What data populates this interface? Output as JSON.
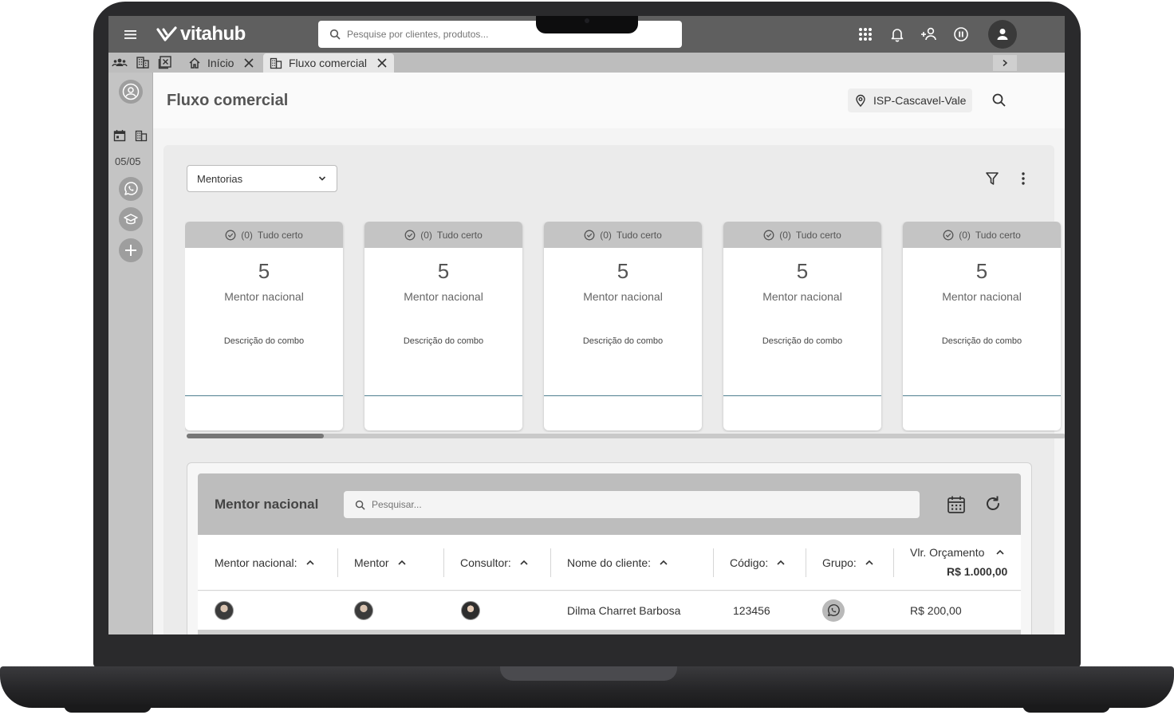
{
  "app": {
    "logo_text": "vitahub"
  },
  "search": {
    "placeholder": "Pesquise por clientes, produtos..."
  },
  "tabs": [
    {
      "label": "Início"
    },
    {
      "label": "Fluxo comercial"
    }
  ],
  "rail": {
    "date": "05/05"
  },
  "page": {
    "title": "Fluxo comercial",
    "location": "ISP-Cascavel-Vale"
  },
  "filter": {
    "selected": "Mentorias"
  },
  "cards": [
    {
      "status_count": "(0)",
      "status": "Tudo certo",
      "number": "5",
      "label": "Mentor nacional",
      "description": "Descrição do combo"
    },
    {
      "status_count": "(0)",
      "status": "Tudo certo",
      "number": "5",
      "label": "Mentor nacional",
      "description": "Descrição do combo"
    },
    {
      "status_count": "(0)",
      "status": "Tudo certo",
      "number": "5",
      "label": "Mentor nacional",
      "description": "Descrição do combo"
    },
    {
      "status_count": "(0)",
      "status": "Tudo certo",
      "number": "5",
      "label": "Mentor nacional",
      "description": "Descrição do combo"
    },
    {
      "status_count": "(0)",
      "status": "Tudo certo",
      "number": "5",
      "label": "Mentor nacional",
      "description": "Descrição do combo"
    }
  ],
  "table": {
    "title": "Mentor nacional",
    "search_placeholder": "Pesquisar...",
    "columns": {
      "mentor_nacional": "Mentor nacional:",
      "mentor": "Mentor",
      "consultor": "Consultor:",
      "nome_cliente": "Nome do cliente:",
      "codigo": "Código:",
      "grupo": "Grupo:",
      "vlr_orcamento": "Vlr. Orçamento",
      "vlr_total": "R$ 1.000,00"
    },
    "rows": [
      {
        "nome_cliente": "Dilma Charret Barbosa",
        "codigo": "123456",
        "vlr_orcamento": "R$ 200,00"
      }
    ]
  },
  "colors": {
    "topbar": "#5f5f5f",
    "accent_line": "#4f7f8f"
  }
}
